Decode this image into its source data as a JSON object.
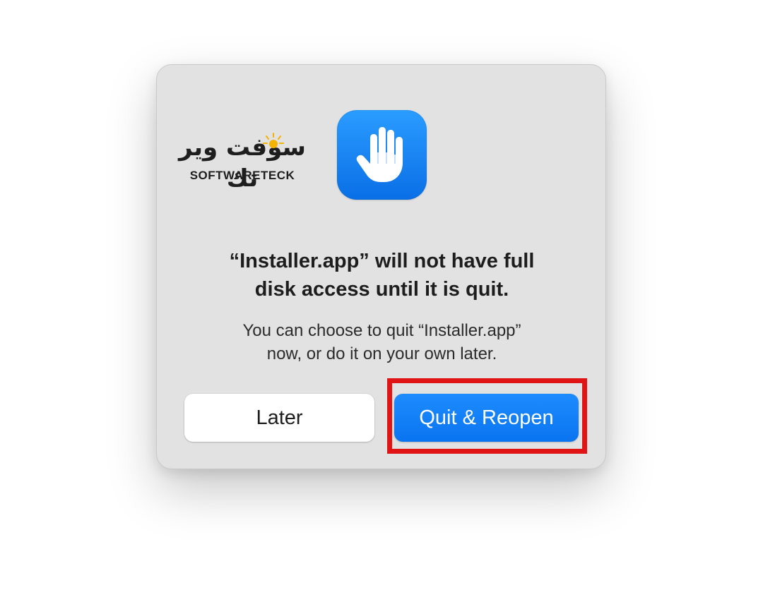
{
  "dialog": {
    "title_line1": "“Installer.app” will not have full",
    "title_line2": "disk access until it is quit.",
    "body_line1": "You can choose to quit “Installer.app”",
    "body_line2": "now, or do it on your own later.",
    "icon": "raised-hand-icon",
    "icon_color": "#1a86f7"
  },
  "buttons": {
    "later_label": "Later",
    "quit_label": "Quit & Reopen",
    "accent_color": "#0a7aff"
  },
  "watermark": {
    "arabic": "سوفت وير تك",
    "latin": "SOFTWARETECK"
  },
  "annotation": {
    "highlight_color": "#e01414"
  }
}
